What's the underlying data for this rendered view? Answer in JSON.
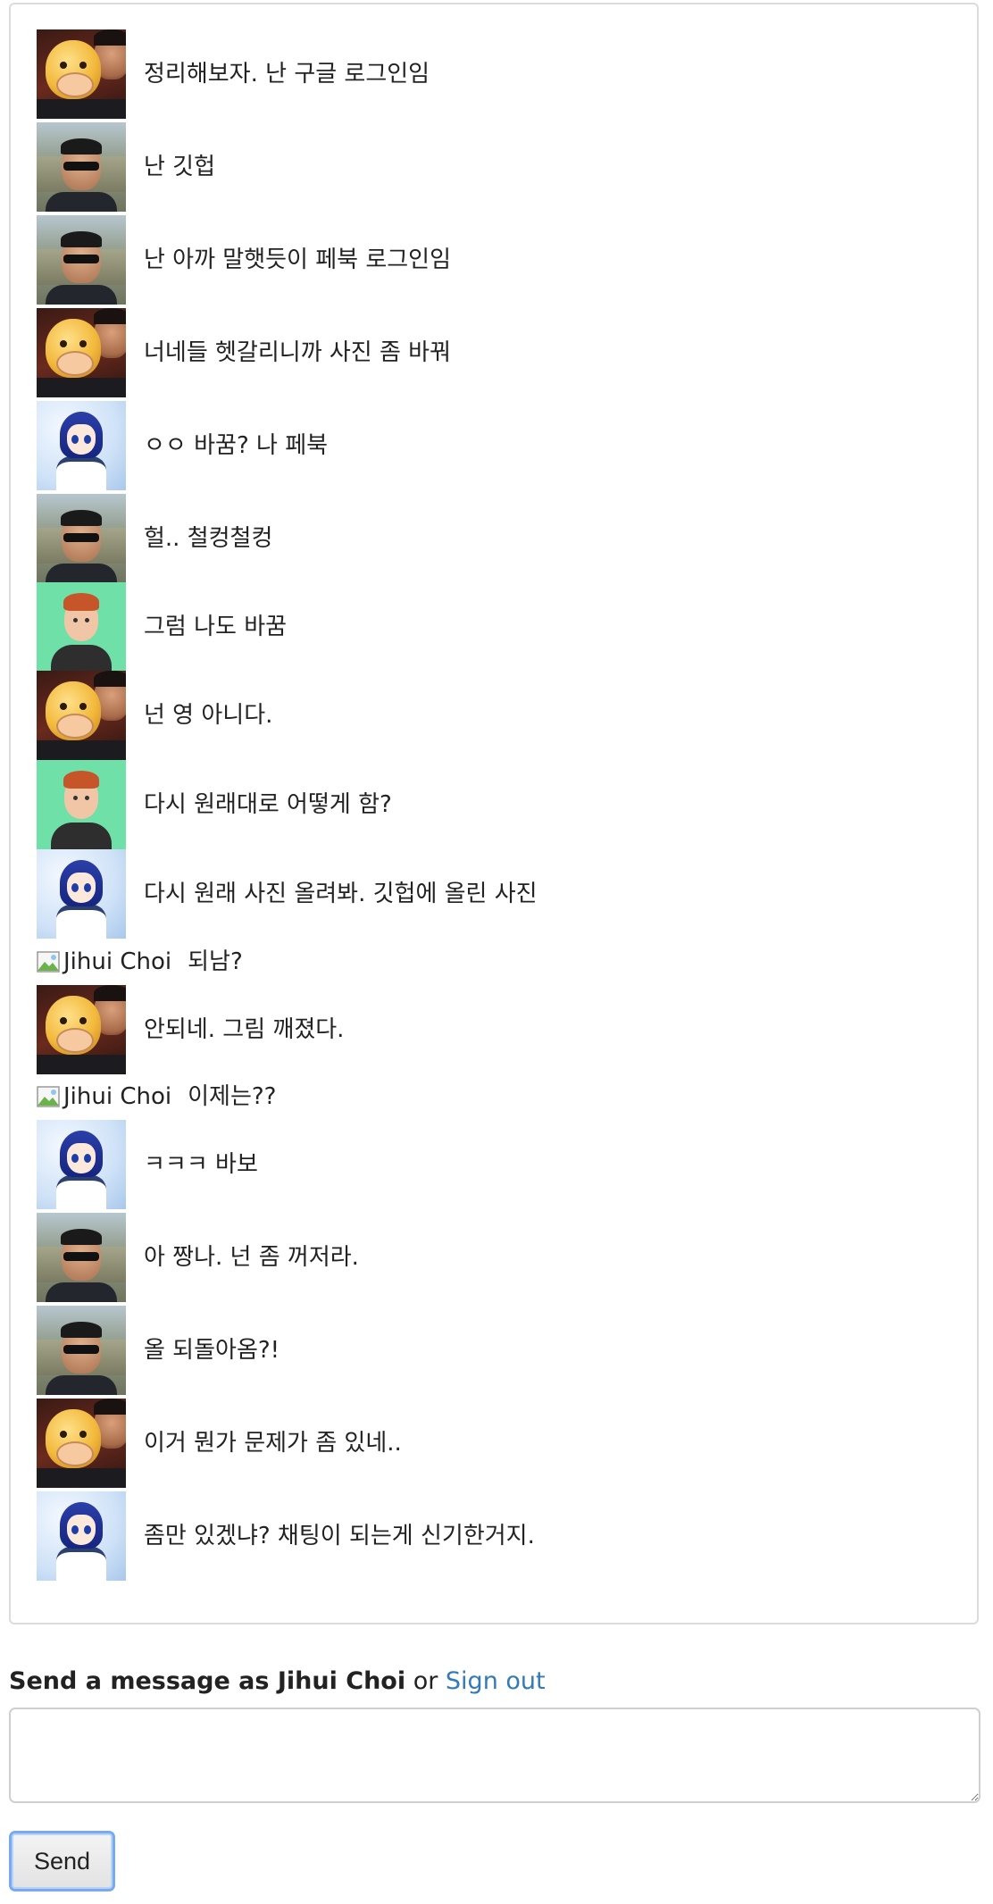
{
  "messages": [
    {
      "avatar": "pig-avatar",
      "text": "정리해보자. 난 구글 로그인임"
    },
    {
      "avatar": "sunglasses-avatar",
      "text": "난 깃헙"
    },
    {
      "avatar": "sunglasses-avatar",
      "text": "난 아까 말햇듯이 페북 로그인임"
    },
    {
      "avatar": "pig-avatar",
      "text": "너네들 헷갈리니까 사진 좀 바꿔"
    },
    {
      "avatar": "anime-avatar",
      "text": "ㅇㅇ 바꿈? 나 페북"
    },
    {
      "avatar": "sunglasses-avatar",
      "text": "헐.. 철컹철컹"
    },
    {
      "avatar": "cartoon-boy-avatar",
      "text": "그럼 나도 바꿈"
    },
    {
      "avatar": "pig-avatar",
      "text": "넌 영 아니다."
    },
    {
      "avatar": "cartoon-boy-avatar",
      "text": "다시 원래대로 어떻게 함?"
    },
    {
      "avatar": "anime-avatar",
      "text": "다시 원래 사진 올려봐. 깃헙에 올린 사진"
    },
    {
      "avatar": "broken-image",
      "alt": "Jihui Choi",
      "text": "되남?"
    },
    {
      "avatar": "pig-avatar",
      "text": "안되네. 그림 깨졌다."
    },
    {
      "avatar": "broken-image",
      "alt": "Jihui Choi",
      "text": "이제는??"
    },
    {
      "avatar": "anime-avatar",
      "text": "ㅋㅋㅋ 바보"
    },
    {
      "avatar": "sunglasses-avatar",
      "text": "아 짱나. 넌 좀 꺼저라."
    },
    {
      "avatar": "sunglasses-avatar",
      "text": "올 되돌아옴?!"
    },
    {
      "avatar": "pig-avatar",
      "text": "이거 뭔가 문제가 좀 있네.."
    },
    {
      "avatar": "anime-avatar",
      "text": "좀만 있겠냐? 채팅이 되는게 신기한거지."
    }
  ],
  "compose": {
    "label_prefix": "Send a message as Jihui Choi",
    "or_text": "or",
    "signout_label": "Sign out",
    "input_value": "",
    "send_label": "Send"
  },
  "colors": {
    "link": "#337ab7",
    "panel_border": "#dcdcdc",
    "button_focus": "#77aaf0"
  }
}
